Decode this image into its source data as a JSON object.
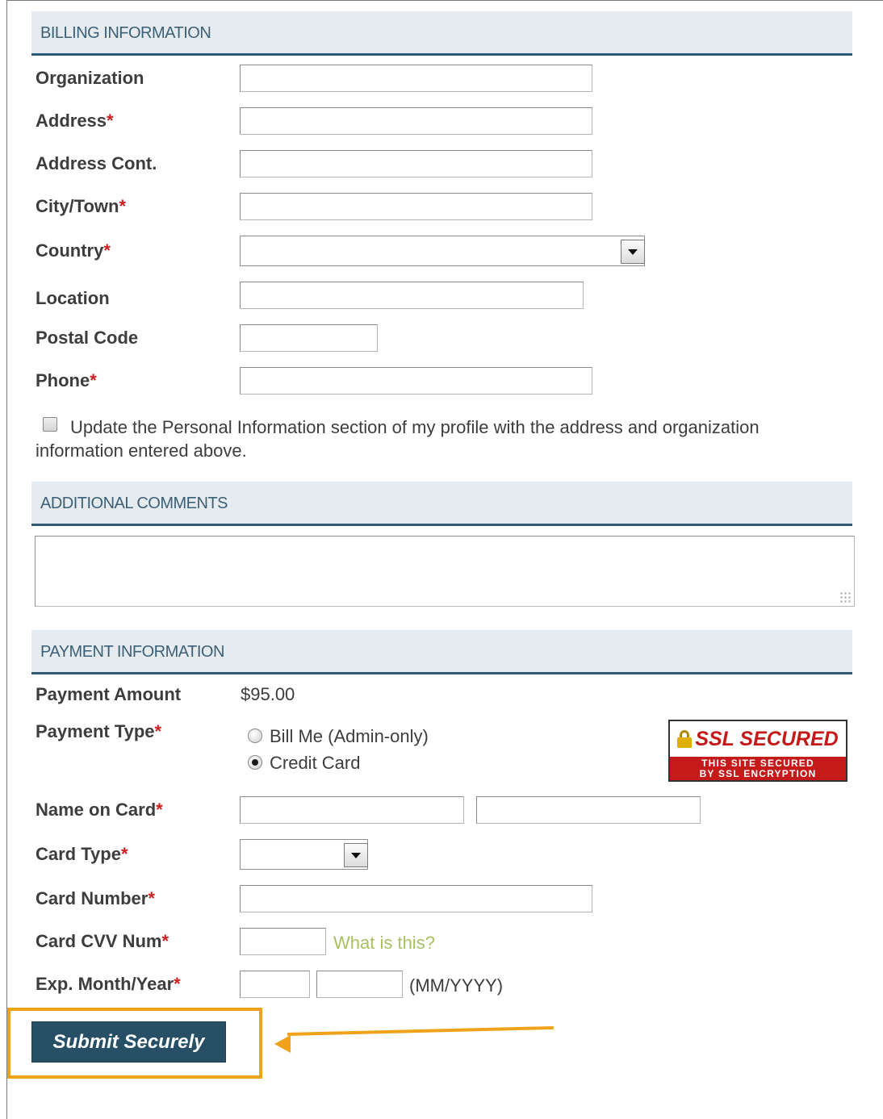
{
  "billing": {
    "header": "BILLING INFORMATION",
    "organization_label": "Organization",
    "address_label": "Address",
    "address_cont_label": "Address Cont.",
    "city_label": "City/Town",
    "country_label": "Country",
    "location_label": "Location",
    "postal_label": "Postal Code",
    "phone_label": "Phone",
    "required_mark": "*",
    "update_profile_text": "Update the Personal Information section of my profile with the address and organization information entered above."
  },
  "comments": {
    "header": "ADDITIONAL COMMENTS"
  },
  "payment": {
    "header": "PAYMENT INFORMATION",
    "amount_label": "Payment Amount",
    "amount_value": "$95.00",
    "type_label": "Payment Type",
    "options": [
      "Bill Me (Admin-only)",
      "Credit Card"
    ],
    "selected_option": "Credit Card",
    "name_label": "Name on Card",
    "card_type_label": "Card Type",
    "card_number_label": "Card Number",
    "cvv_label": "Card CVV Num",
    "cvv_help": "What is this?",
    "exp_label": "Exp. Month/Year",
    "exp_format": "(MM/YYYY)",
    "ssl_title": "SSL SECURED",
    "ssl_line1": "THIS SITE SECURED",
    "ssl_line2": "BY SSL ENCRYPTION"
  },
  "submit_label": "Submit Securely",
  "colors": {
    "header_bg": "#e6ebef",
    "header_rule": "#2d5a72",
    "button_bg": "#274f66",
    "highlight": "#f0a31a",
    "required": "#cc2020",
    "link": "#a9bf62"
  }
}
